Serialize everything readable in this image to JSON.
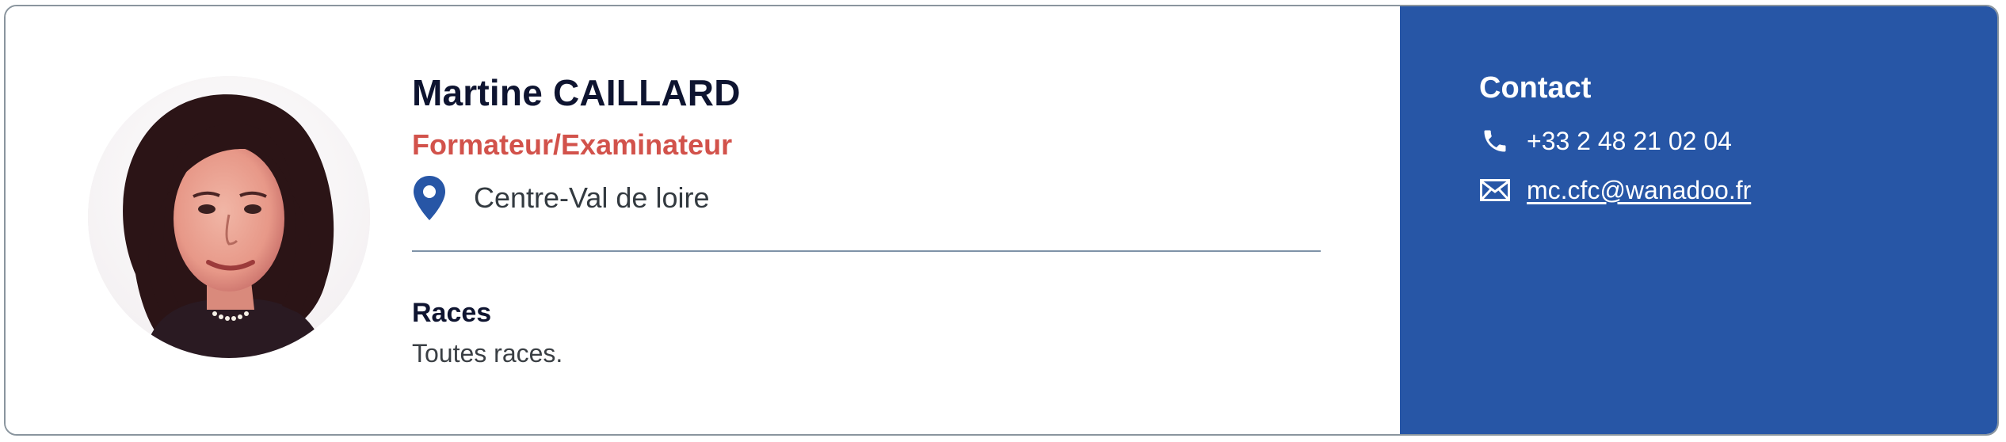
{
  "profile": {
    "name": "Martine CAILLARD",
    "role": "Formateur/Examinateur",
    "location": "Centre-Val de loire"
  },
  "races": {
    "title": "Races",
    "text": "Toutes races."
  },
  "contact": {
    "title": "Contact",
    "phone": "+33 2 48 21 02 04",
    "email": "mc.cfc@wanadoo.fr"
  },
  "icons": {
    "location": "map-pin-icon",
    "phone": "phone-icon",
    "email": "envelope-icon"
  },
  "colors": {
    "contact_panel_bg": "#2756a6",
    "role_text": "#d2524b",
    "name_text": "#0e1430",
    "pin": "#2756a6",
    "divider": "#7f93a8"
  }
}
